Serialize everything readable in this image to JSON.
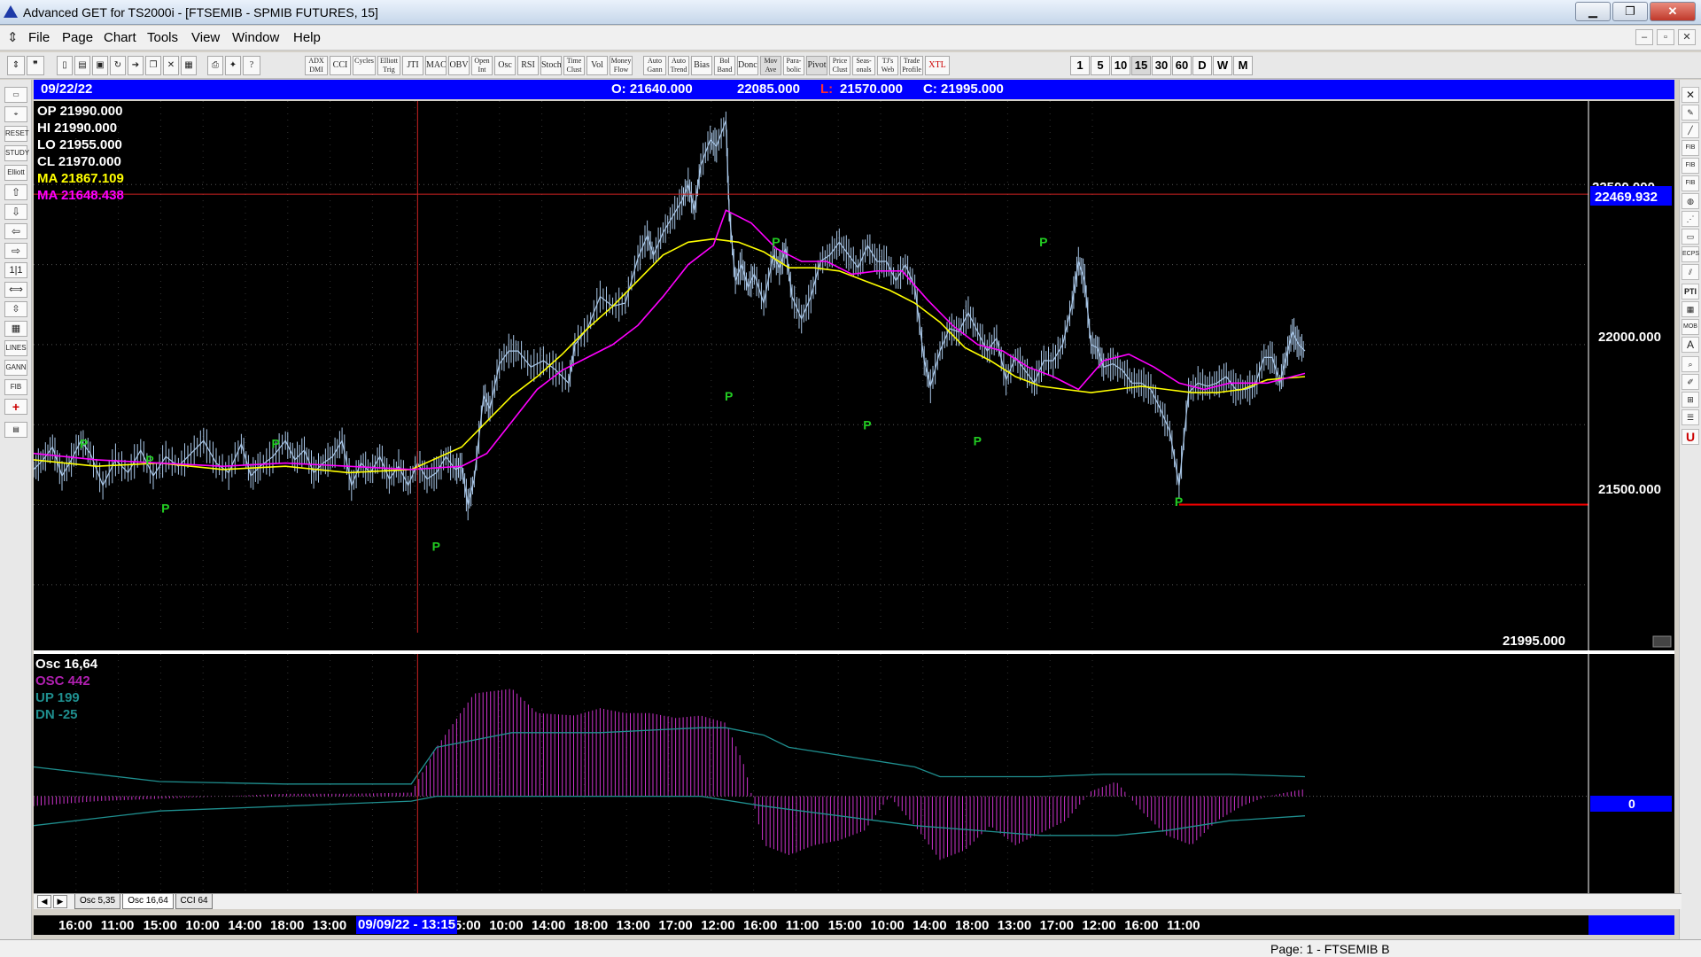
{
  "window": {
    "title": "Advanced GET for TS2000i - [FTSEMIB - SPMIB FUTURES, 15]",
    "min": "▁",
    "max": "❐",
    "close": "✕"
  },
  "menu": {
    "items": [
      "File",
      "Page",
      "Chart",
      "Tools",
      "View",
      "Window",
      "Help"
    ],
    "mdi": [
      "–",
      "▫",
      "✕"
    ]
  },
  "toolbar": {
    "studies": [
      "ADX DMI",
      "CCI",
      "Cycles",
      "Elliott Trig",
      "JTI",
      "MACD",
      "OBV",
      "Open Int",
      "Osc",
      "RSI",
      "Stoch",
      "Time Clust",
      "Vol",
      "Money Flow",
      "Auto Gann",
      "Auto Trend",
      "Bias",
      "Bol Band",
      "Donch",
      "Mov Ave",
      "Para-bolic",
      "Pivot",
      "Price Clust",
      "Seas-onals",
      "TJ's Web",
      "Trade Profile",
      "XTL"
    ],
    "timeframes": [
      "1",
      "5",
      "10",
      "15",
      "30",
      "60",
      "D",
      "W",
      "M"
    ],
    "selected_timeframe": "15"
  },
  "info_bar": {
    "date": "09/22/22",
    "open": "O: 21640.000",
    "high": "22085.000",
    "low_label": "L:",
    "low": "21570.000",
    "close": "C: 21995.000"
  },
  "legend": {
    "op": "OP  21990.000",
    "hi": "HI   21990.000",
    "lo": "LO  21955.000",
    "cl": "CL  21970.000",
    "ma1": "MA  21867.109",
    "ma2": "MA  21648.438"
  },
  "price_axis": {
    "label_22500": "22500.000",
    "label_22000": "22000.000",
    "label_21500": "21500.000",
    "hline_label": "22469.932",
    "current": "21995.000"
  },
  "pivot_label": "P",
  "osc_legend": {
    "title": "Osc 16,64",
    "osc": "OSC 442",
    "up": "UP   199",
    "dn": "DN   -25",
    "zero": "0"
  },
  "tabs": [
    "Osc 5,35",
    "Osc 16,64",
    "CCI 64"
  ],
  "tab_nav": [
    "◀",
    "▶"
  ],
  "time_axis": {
    "labels": [
      "16:00",
      "11:00",
      "15:00",
      "10:00",
      "14:00",
      "18:00",
      "13:00",
      "0",
      "11:00",
      "15:00",
      "10:00",
      "14:00",
      "18:00",
      "13:00",
      "17:00",
      "12:00",
      "16:00",
      "11:00",
      "15:00",
      "10:00",
      "14:00",
      "18:00",
      "13:00",
      "17:00",
      "12:00",
      "16:00",
      "11:00"
    ],
    "cursor": "09/09/22 - 13:15"
  },
  "status": "Page: 1 - FTSEMIB B",
  "colors": {
    "price": "#a9c7e8",
    "ma_fast": "#ffff00",
    "ma_slow": "#ff00ff",
    "osc_bar": "#cc33cc",
    "band": "#1f8f8f",
    "hline": "#ff0000",
    "pivot": "#22cc22",
    "axis_blue": "#0000ff"
  },
  "chart_data": {
    "type": "line",
    "ylim": [
      21100,
      22750
    ],
    "price_path": [
      [
        0,
        21610
      ],
      [
        15,
        21640
      ],
      [
        30,
        21680
      ],
      [
        45,
        21590
      ],
      [
        60,
        21640
      ],
      [
        75,
        21700
      ],
      [
        90,
        21660
      ],
      [
        110,
        21560
      ],
      [
        130,
        21640
      ],
      [
        150,
        21600
      ],
      [
        170,
        21670
      ],
      [
        190,
        21590
      ],
      [
        210,
        21650
      ],
      [
        230,
        21620
      ],
      [
        250,
        21660
      ],
      [
        270,
        21700
      ],
      [
        290,
        21630
      ],
      [
        310,
        21600
      ],
      [
        330,
        21690
      ],
      [
        345,
        21590
      ],
      [
        360,
        21620
      ],
      [
        380,
        21650
      ],
      [
        400,
        21700
      ],
      [
        415,
        21640
      ],
      [
        430,
        21670
      ],
      [
        445,
        21600
      ],
      [
        460,
        21630
      ],
      [
        475,
        21650
      ],
      [
        490,
        21700
      ],
      [
        505,
        21560
      ],
      [
        520,
        21630
      ],
      [
        535,
        21600
      ],
      [
        550,
        21650
      ],
      [
        565,
        21580
      ],
      [
        580,
        21620
      ],
      [
        595,
        21560
      ],
      [
        610,
        21630
      ],
      [
        625,
        21580
      ],
      [
        640,
        21600
      ],
      [
        655,
        21650
      ],
      [
        670,
        21610
      ],
      [
        680,
        21620
      ],
      [
        690,
        21500
      ],
      [
        700,
        21580
      ],
      [
        715,
        21840
      ],
      [
        725,
        21800
      ],
      [
        740,
        21940
      ],
      [
        755,
        21980
      ],
      [
        770,
        21980
      ],
      [
        790,
        21930
      ],
      [
        810,
        21950
      ],
      [
        830,
        21920
      ],
      [
        850,
        21880
      ],
      [
        860,
        22000
      ],
      [
        880,
        22050
      ],
      [
        900,
        22150
      ],
      [
        920,
        22120
      ],
      [
        940,
        22130
      ],
      [
        960,
        22270
      ],
      [
        975,
        22340
      ],
      [
        985,
        22280
      ],
      [
        1000,
        22350
      ],
      [
        1015,
        22400
      ],
      [
        1030,
        22450
      ],
      [
        1040,
        22500
      ],
      [
        1050,
        22420
      ],
      [
        1060,
        22560
      ],
      [
        1075,
        22640
      ],
      [
        1085,
        22620
      ],
      [
        1100,
        22700
      ],
      [
        1105,
        22420
      ],
      [
        1115,
        22200
      ],
      [
        1125,
        22250
      ],
      [
        1135,
        22180
      ],
      [
        1145,
        22220
      ],
      [
        1160,
        22130
      ],
      [
        1175,
        22280
      ],
      [
        1185,
        22240
      ],
      [
        1195,
        22300
      ],
      [
        1205,
        22150
      ],
      [
        1220,
        22080
      ],
      [
        1235,
        22150
      ],
      [
        1250,
        22260
      ],
      [
        1265,
        22280
      ],
      [
        1280,
        22320
      ],
      [
        1295,
        22280
      ],
      [
        1310,
        22240
      ],
      [
        1325,
        22310
      ],
      [
        1340,
        22260
      ],
      [
        1355,
        22260
      ],
      [
        1370,
        22200
      ],
      [
        1385,
        22250
      ],
      [
        1400,
        22180
      ],
      [
        1415,
        21950
      ],
      [
        1425,
        21870
      ],
      [
        1440,
        21980
      ],
      [
        1455,
        22050
      ],
      [
        1470,
        22040
      ],
      [
        1485,
        22100
      ],
      [
        1500,
        22040
      ],
      [
        1515,
        21980
      ],
      [
        1530,
        22020
      ],
      [
        1545,
        21890
      ],
      [
        1560,
        21960
      ],
      [
        1575,
        21920
      ],
      [
        1590,
        21880
      ],
      [
        1605,
        21950
      ],
      [
        1620,
        21950
      ],
      [
        1635,
        22000
      ],
      [
        1650,
        22130
      ],
      [
        1660,
        22260
      ],
      [
        1670,
        22200
      ],
      [
        1680,
        22000
      ],
      [
        1690,
        21990
      ],
      [
        1700,
        21930
      ],
      [
        1715,
        21940
      ],
      [
        1730,
        21920
      ],
      [
        1745,
        21880
      ],
      [
        1760,
        21880
      ],
      [
        1775,
        21860
      ],
      [
        1790,
        21800
      ],
      [
        1805,
        21730
      ],
      [
        1820,
        21560
      ],
      [
        1835,
        21850
      ],
      [
        1850,
        21880
      ],
      [
        1865,
        21870
      ],
      [
        1880,
        21880
      ],
      [
        1895,
        21900
      ],
      [
        1910,
        21860
      ],
      [
        1925,
        21860
      ],
      [
        1940,
        21870
      ],
      [
        1955,
        21960
      ],
      [
        1968,
        21960
      ],
      [
        1980,
        21880
      ],
      [
        1990,
        21960
      ],
      [
        2000,
        22040
      ],
      [
        2010,
        22000
      ],
      [
        2020,
        21980
      ]
    ],
    "ma_fast": [
      [
        0,
        21640
      ],
      [
        100,
        21620
      ],
      [
        200,
        21630
      ],
      [
        300,
        21610
      ],
      [
        400,
        21620
      ],
      [
        500,
        21600
      ],
      [
        600,
        21610
      ],
      [
        680,
        21680
      ],
      [
        720,
        21760
      ],
      [
        760,
        21840
      ],
      [
        800,
        21900
      ],
      [
        840,
        21970
      ],
      [
        880,
        22050
      ],
      [
        920,
        22120
      ],
      [
        960,
        22200
      ],
      [
        1000,
        22280
      ],
      [
        1040,
        22320
      ],
      [
        1080,
        22330
      ],
      [
        1120,
        22320
      ],
      [
        1160,
        22290
      ],
      [
        1200,
        22240
      ],
      [
        1240,
        22240
      ],
      [
        1280,
        22230
      ],
      [
        1320,
        22200
      ],
      [
        1360,
        22170
      ],
      [
        1400,
        22130
      ],
      [
        1440,
        22070
      ],
      [
        1480,
        21990
      ],
      [
        1520,
        21950
      ],
      [
        1560,
        21900
      ],
      [
        1600,
        21870
      ],
      [
        1640,
        21860
      ],
      [
        1680,
        21850
      ],
      [
        1720,
        21860
      ],
      [
        1760,
        21870
      ],
      [
        1800,
        21860
      ],
      [
        1840,
        21850
      ],
      [
        1880,
        21850
      ],
      [
        1920,
        21860
      ],
      [
        1960,
        21890
      ],
      [
        2020,
        21900
      ]
    ],
    "ma_slow": [
      [
        0,
        21660
      ],
      [
        100,
        21640
      ],
      [
        200,
        21630
      ],
      [
        300,
        21620
      ],
      [
        400,
        21630
      ],
      [
        500,
        21620
      ],
      [
        600,
        21610
      ],
      [
        680,
        21620
      ],
      [
        720,
        21660
      ],
      [
        760,
        21760
      ],
      [
        800,
        21860
      ],
      [
        840,
        21920
      ],
      [
        880,
        21960
      ],
      [
        920,
        22000
      ],
      [
        960,
        22060
      ],
      [
        1000,
        22150
      ],
      [
        1040,
        22250
      ],
      [
        1080,
        22310
      ],
      [
        1100,
        22420
      ],
      [
        1140,
        22380
      ],
      [
        1180,
        22300
      ],
      [
        1220,
        22260
      ],
      [
        1260,
        22260
      ],
      [
        1300,
        22220
      ],
      [
        1340,
        22230
      ],
      [
        1380,
        22230
      ],
      [
        1420,
        22140
      ],
      [
        1460,
        22060
      ],
      [
        1500,
        22000
      ],
      [
        1540,
        21980
      ],
      [
        1580,
        21930
      ],
      [
        1620,
        21900
      ],
      [
        1660,
        21860
      ],
      [
        1700,
        21950
      ],
      [
        1740,
        21970
      ],
      [
        1780,
        21930
      ],
      [
        1820,
        21880
      ],
      [
        1860,
        21860
      ],
      [
        1900,
        21880
      ],
      [
        1960,
        21880
      ],
      [
        2020,
        21910
      ]
    ],
    "pivots_high": [
      [
        80,
        21660
      ],
      [
        185,
        21610
      ],
      [
        385,
        21660
      ],
      [
        1180,
        22290
      ],
      [
        1605,
        22290
      ]
    ],
    "pivots_low": [
      [
        210,
        21520
      ],
      [
        640,
        21400
      ],
      [
        1105,
        21870
      ],
      [
        1325,
        21780
      ],
      [
        1500,
        21730
      ],
      [
        1820,
        21540
      ]
    ],
    "hlines": [
      {
        "value": 22469.932,
        "from": 0,
        "to": 2020
      },
      {
        "value": 21500,
        "from": 1820,
        "to": 2020
      }
    ],
    "vline_x": 610,
    "x_total": 2020,
    "osc_values": [
      [
        0,
        -40
      ],
      [
        100,
        -20
      ],
      [
        200,
        -10
      ],
      [
        300,
        0
      ],
      [
        400,
        10
      ],
      [
        500,
        10
      ],
      [
        600,
        15
      ],
      [
        640,
        200
      ],
      [
        700,
        420
      ],
      [
        760,
        440
      ],
      [
        800,
        340
      ],
      [
        860,
        330
      ],
      [
        900,
        360
      ],
      [
        940,
        340
      ],
      [
        980,
        340
      ],
      [
        1020,
        320
      ],
      [
        1060,
        330
      ],
      [
        1100,
        300
      ],
      [
        1130,
        120
      ],
      [
        1160,
        -200
      ],
      [
        1200,
        -240
      ],
      [
        1240,
        -200
      ],
      [
        1280,
        -180
      ],
      [
        1320,
        -140
      ],
      [
        1360,
        0
      ],
      [
        1400,
        -120
      ],
      [
        1440,
        -260
      ],
      [
        1480,
        -220
      ],
      [
        1520,
        -120
      ],
      [
        1560,
        -200
      ],
      [
        1600,
        -150
      ],
      [
        1640,
        -100
      ],
      [
        1680,
        20
      ],
      [
        1720,
        60
      ],
      [
        1760,
        -60
      ],
      [
        1800,
        -160
      ],
      [
        1840,
        -200
      ],
      [
        1880,
        -100
      ],
      [
        1920,
        -40
      ],
      [
        1960,
        0
      ],
      [
        2000,
        20
      ],
      [
        2020,
        30
      ]
    ],
    "osc_up": [
      [
        0,
        120
      ],
      [
        200,
        60
      ],
      [
        400,
        50
      ],
      [
        600,
        50
      ],
      [
        640,
        200
      ],
      [
        760,
        260
      ],
      [
        900,
        260
      ],
      [
        1060,
        280
      ],
      [
        1100,
        280
      ],
      [
        1160,
        250
      ],
      [
        1200,
        200
      ],
      [
        1400,
        120
      ],
      [
        1440,
        80
      ],
      [
        1600,
        80
      ],
      [
        1700,
        90
      ],
      [
        1800,
        90
      ],
      [
        1900,
        90
      ],
      [
        2020,
        80
      ]
    ],
    "osc_dn": [
      [
        0,
        -120
      ],
      [
        200,
        -60
      ],
      [
        400,
        -40
      ],
      [
        600,
        -20
      ],
      [
        640,
        0
      ],
      [
        1060,
        0
      ],
      [
        1160,
        -40
      ],
      [
        1400,
        -120
      ],
      [
        1600,
        -160
      ],
      [
        1720,
        -160
      ],
      [
        1800,
        -140
      ],
      [
        1900,
        -100
      ],
      [
        2020,
        -80
      ]
    ],
    "osc_ylim": [
      -360,
      560
    ]
  }
}
